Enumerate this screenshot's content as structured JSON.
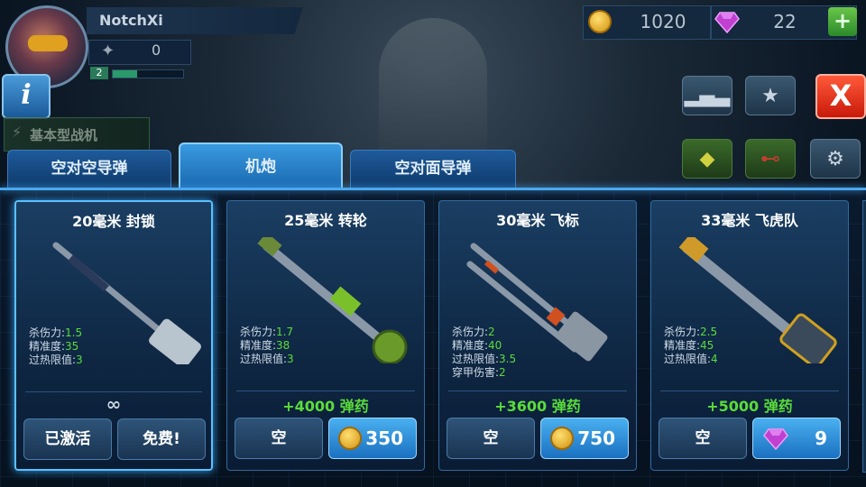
{
  "player": {
    "name": "NotchXi",
    "rank_count": "0",
    "level": "2",
    "xp_progress": 0.35,
    "fighter_type": "基本型战机"
  },
  "currency": {
    "coins": "1020",
    "gems": "22",
    "add_label": "+"
  },
  "buttons": {
    "info_label": "i",
    "close_label": "X"
  },
  "tabs": [
    {
      "label": "空对空导弹",
      "active": false
    },
    {
      "label": "机炮",
      "active": true
    },
    {
      "label": "空对面导弹",
      "active": false
    }
  ],
  "stat_labels": {
    "damage": "杀伤力:",
    "accuracy": "精准度:",
    "overheat": "过热限值:",
    "pierce": "穿甲伤害:"
  },
  "weapons": [
    {
      "name": "20毫米 封锁",
      "damage": "1.5",
      "accuracy": "35",
      "overheat": "3",
      "ammo": "∞",
      "left_button": "已激活",
      "right_button": "免费!"
    },
    {
      "name": "25毫米 转轮",
      "damage": "1.7",
      "accuracy": "38",
      "overheat": "3",
      "ammo": "+4000 弹药",
      "left_button": "空",
      "price": "350",
      "currency": "coin"
    },
    {
      "name": "30毫米 飞标",
      "damage": "2",
      "accuracy": "40",
      "overheat": "3.5",
      "pierce": "2",
      "ammo": "+3600 弹药",
      "left_button": "空",
      "price": "750",
      "currency": "coin"
    },
    {
      "name": "33毫米 飞虎队",
      "damage": "2.5",
      "accuracy": "45",
      "overheat": "4",
      "ammo": "+5000 弹药",
      "left_button": "空",
      "price": "9",
      "currency": "gem"
    }
  ],
  "colors": {
    "stat_value": "#5adc3a",
    "tab_active": "#3a9ae0",
    "close": "#e02a1a"
  }
}
